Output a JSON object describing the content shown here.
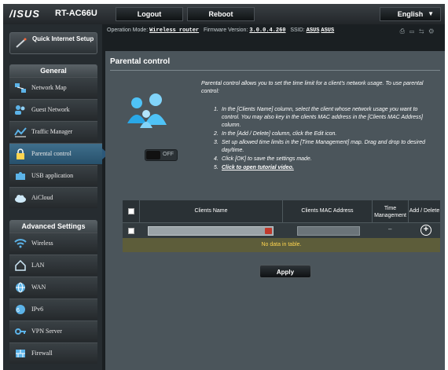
{
  "brand": {
    "logo": "/ISUS",
    "model": "RT-AC66U"
  },
  "topbar": {
    "logout": "Logout",
    "reboot": "Reboot",
    "language": "English"
  },
  "status": {
    "op_mode_label": "Operation Mode:",
    "op_mode_value": "Wireless router",
    "firmware_label": "Firmware Version:",
    "firmware_value": "3.0.0.4.260",
    "ssid_label": "SSID:",
    "ssid_values": [
      "ASUS",
      "ASUS"
    ]
  },
  "sidebar": {
    "quick_setup": "Quick Internet Setup",
    "general_title": "General",
    "general_items": [
      {
        "label": "Network Map",
        "icon": "network-map-icon"
      },
      {
        "label": "Guest Network",
        "icon": "guest-network-icon"
      },
      {
        "label": "Traffic Manager",
        "icon": "traffic-manager-icon"
      },
      {
        "label": "Parental control",
        "icon": "lock-icon"
      },
      {
        "label": "USB application",
        "icon": "usb-puzzle-icon"
      },
      {
        "label": "AiCloud",
        "icon": "cloud-icon"
      }
    ],
    "advanced_title": "Advanced Settings",
    "advanced_items": [
      {
        "label": "Wireless",
        "icon": "wifi-icon"
      },
      {
        "label": "LAN",
        "icon": "home-icon"
      },
      {
        "label": "WAN",
        "icon": "globe-icon"
      },
      {
        "label": "IPv6",
        "icon": "ipv6-globe-icon"
      },
      {
        "label": "VPN Server",
        "icon": "vpn-icon"
      },
      {
        "label": "Firewall",
        "icon": "firewall-icon"
      }
    ]
  },
  "main": {
    "title": "Parental control",
    "description": "Parental control allows you to set the time limit for a client's network usage. To use parental control:",
    "steps": [
      "In the [Clients Name] column, select the client whose network usage you want to control. You may also key in the clients MAC address in the [Clients MAC Address] column.",
      "In the [Add / Delete] column, click the Edit icon.",
      "Set up allowed time limits in the [Time Management] map. Drag and drop to desired day/time.",
      "Click [OK] to save the settings made.",
      "Click to open tutorial video."
    ],
    "toggle_state": "OFF",
    "table": {
      "headers": [
        "Clients Name",
        "Clients MAC Address",
        "Time Management",
        "Add / Delete"
      ],
      "time_mgmt_value": "–",
      "empty_message": "No data in table."
    },
    "apply": "Apply"
  }
}
